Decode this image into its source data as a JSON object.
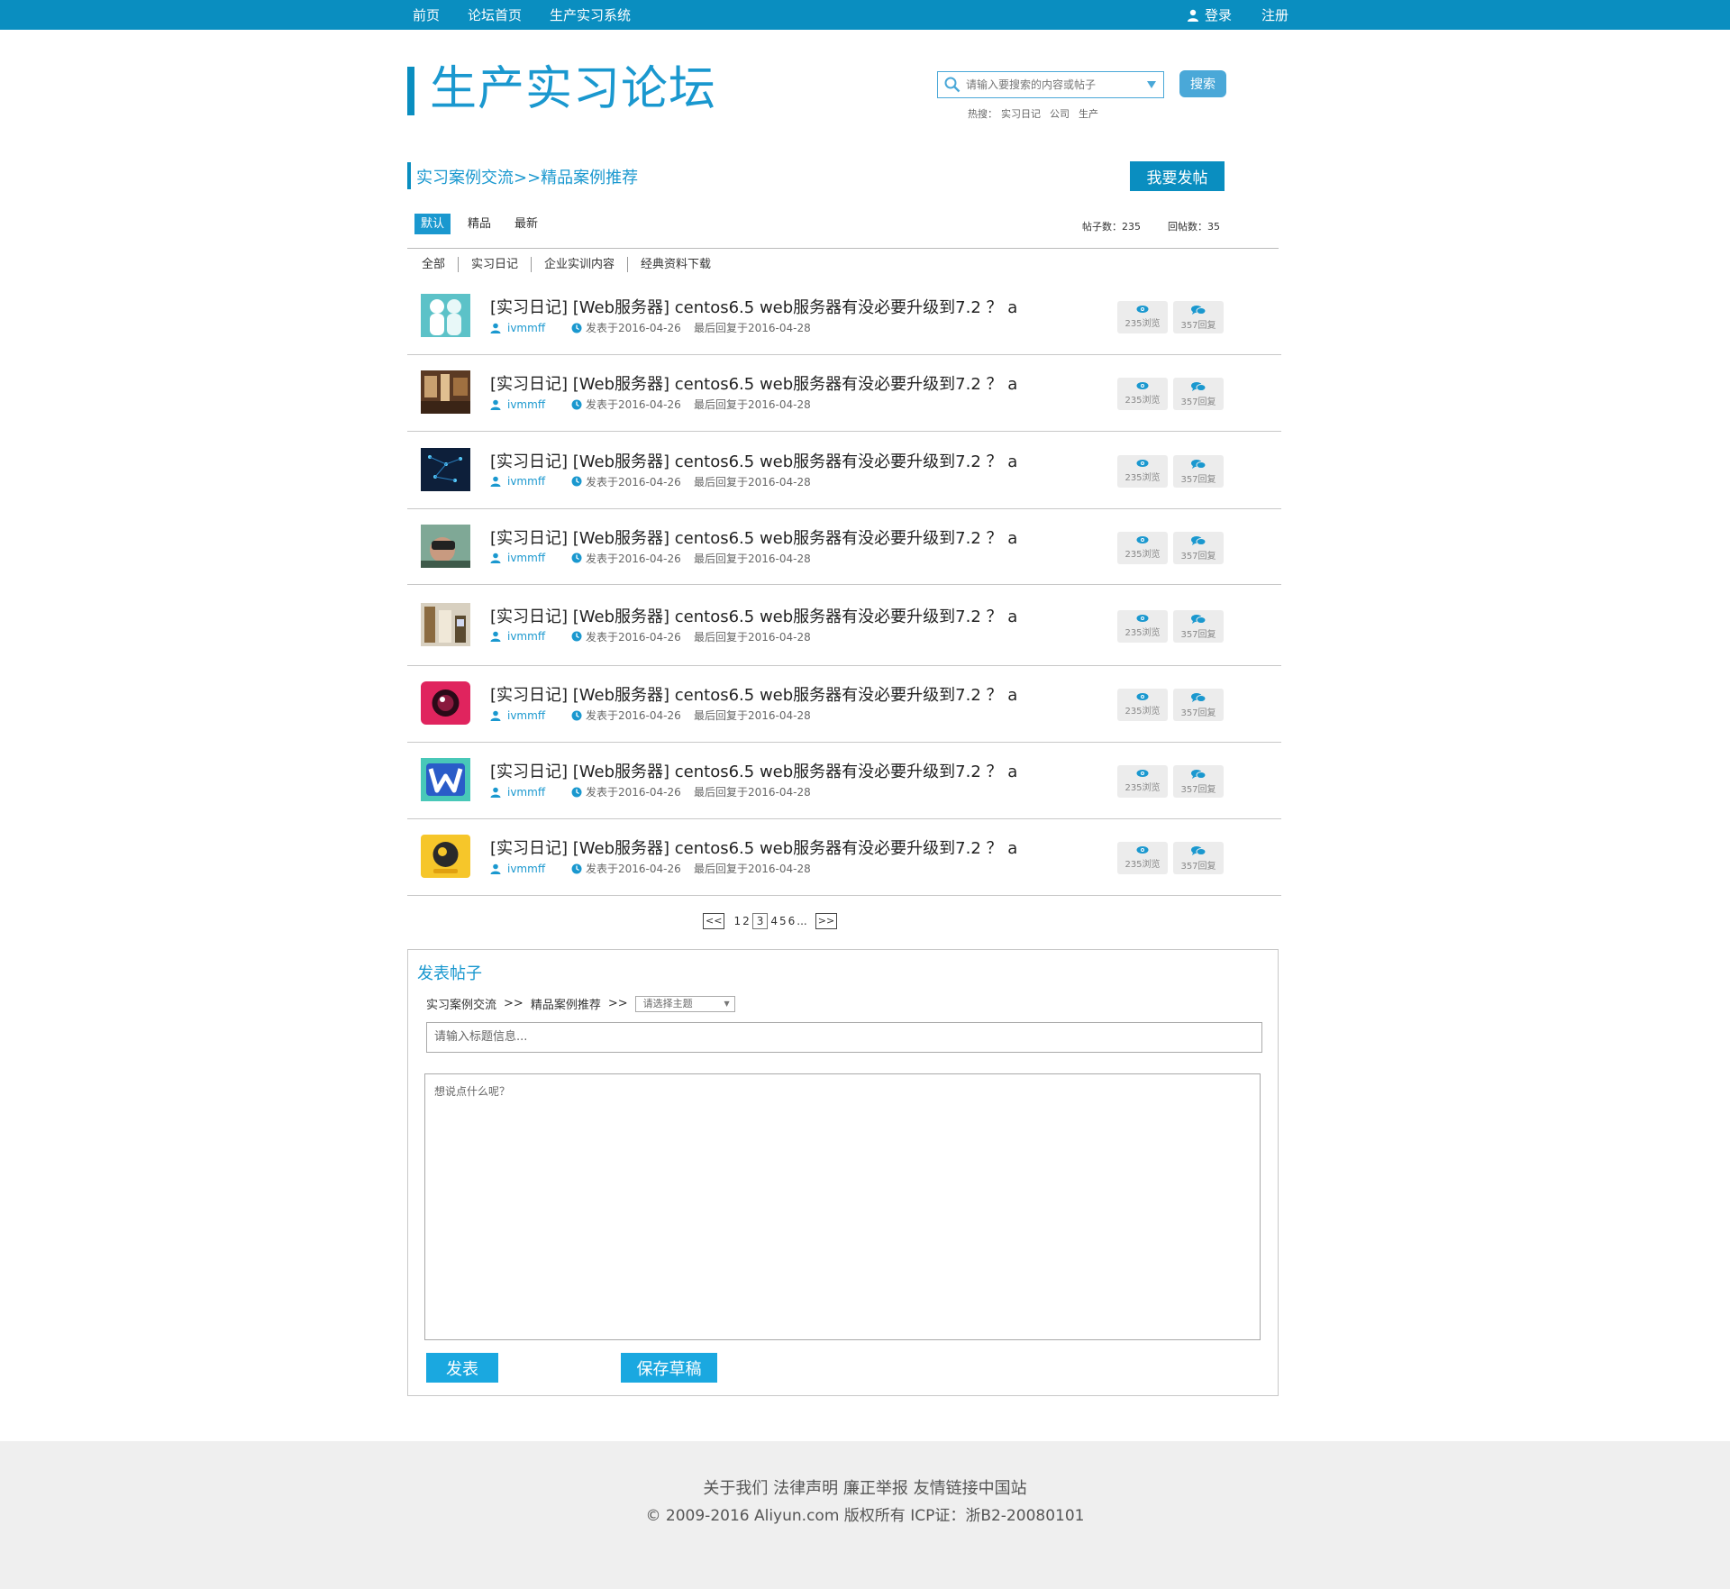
{
  "topnav": {
    "items": [
      "前页",
      "论坛首页",
      "生产实习系统"
    ],
    "login": "登录",
    "register": "注册"
  },
  "header": {
    "title": "生产实习论坛",
    "search_placeholder": "请输入要搜索的内容或帖子",
    "search_button": "搜索",
    "hot_label": "热搜：",
    "hot_items": [
      "实习日记",
      "公司",
      "生产"
    ]
  },
  "breadcrumb": "实习案例交流>>精品案例推荐",
  "post_button": "我要发帖",
  "sort_tabs": [
    "默认",
    "精品",
    "最新"
  ],
  "counts": {
    "posts": "帖子数：235",
    "replies": "回帖数：35"
  },
  "categories": [
    "全部",
    "实习日记",
    "企业实训内容",
    "经典资料下载"
  ],
  "posts": [
    {
      "title": "[实习日记] [Web服务器] centos6.5 web服务器有没必要升级到7.2 ？ a",
      "author": "ivmmff",
      "posted": "发表于2016-04-26",
      "last_reply": "最后回复于2016-04-28",
      "views": "235浏览",
      "replies": "357回复",
      "thumb": "teal"
    },
    {
      "title": "[实习日记] [Web服务器] centos6.5 web服务器有没必要升级到7.2 ？ a",
      "author": "ivmmff",
      "posted": "发表于2016-04-26",
      "last_reply": "最后回复于2016-04-28",
      "views": "235浏览",
      "replies": "357回复",
      "thumb": "room"
    },
    {
      "title": "[实习日记] [Web服务器] centos6.5 web服务器有没必要升级到7.2 ？ a",
      "author": "ivmmff",
      "posted": "发表于2016-04-26",
      "last_reply": "最后回复于2016-04-28",
      "views": "235浏览",
      "replies": "357回复",
      "thumb": "circuit"
    },
    {
      "title": "[实习日记] [Web服务器] centos6.5 web服务器有没必要升级到7.2 ？ a",
      "author": "ivmmff",
      "posted": "发表于2016-04-26",
      "last_reply": "最后回复于2016-04-28",
      "views": "235浏览",
      "replies": "357回复",
      "thumb": "vr"
    },
    {
      "title": "[实习日记] [Web服务器] centos6.5 web服务器有没必要升级到7.2 ？ a",
      "author": "ivmmff",
      "posted": "发表于2016-04-26",
      "last_reply": "最后回复于2016-04-28",
      "views": "235浏览",
      "replies": "357回复",
      "thumb": "interior"
    },
    {
      "title": "[实习日记] [Web服务器] centos6.5 web服务器有没必要升级到7.2 ？ a",
      "author": "ivmmff",
      "posted": "发表于2016-04-26",
      "last_reply": "最后回复于2016-04-28",
      "views": "235浏览",
      "replies": "357回复",
      "thumb": "camera"
    },
    {
      "title": "[实习日记] [Web服务器] centos6.5 web服务器有没必要升级到7.2 ？ a",
      "author": "ivmmff",
      "posted": "发表于2016-04-26",
      "last_reply": "最后回复于2016-04-28",
      "views": "235浏览",
      "replies": "357回复",
      "thumb": "w-letter"
    },
    {
      "title": "[实习日记] [Web服务器] centos6.5 web服务器有没必要升级到7.2 ？ a",
      "author": "ivmmff",
      "posted": "发表于2016-04-26",
      "last_reply": "最后回复于2016-04-28",
      "views": "235浏览",
      "replies": "357回复",
      "thumb": "yellow-eye"
    }
  ],
  "pagination": {
    "prev": "<<",
    "pages": [
      "1",
      "2",
      "3",
      "4",
      "5",
      "6"
    ],
    "current": "3",
    "ellipsis": "...",
    "next": ">>"
  },
  "compose": {
    "heading": "发表帖子",
    "path_1": "实习案例交流",
    "path_sep": ">>",
    "path_2": "精品案例推荐",
    "topic_select": "请选择主题",
    "title_placeholder": "请输入标题信息...",
    "content_placeholder": "想说点什么呢？",
    "publish": "发表",
    "save_draft": "保存草稿"
  },
  "footer": {
    "links": "关于我们 法律声明 廉正举报 友情链接中国站",
    "copyright": "© 2009-2016 Aliyun.com 版权所有 ICP证：浙B2-20080101"
  },
  "colors": {
    "primary": "#0a8ec0",
    "accent": "#1a98cf",
    "button": "#1aa8e0"
  }
}
